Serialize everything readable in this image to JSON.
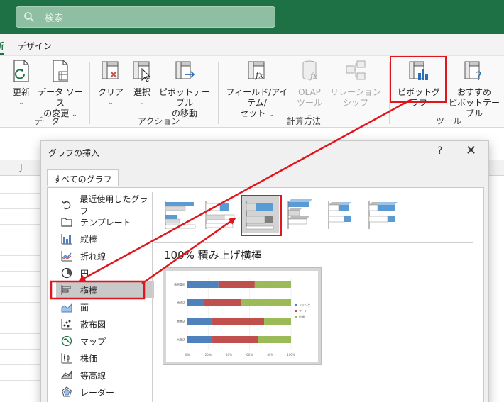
{
  "search": {
    "placeholder": "検索"
  },
  "ribbon": {
    "tabs": {
      "analyze": "析",
      "design": "デザイン"
    },
    "buttons": {
      "refresh": "更新",
      "datasource_1": "データ ソース",
      "datasource_2": "の変更",
      "clear": "クリア",
      "select": "選択",
      "move_1": "ピボットテーブル",
      "move_2": "の移動",
      "fields_1": "フィールド/アイテム/",
      "fields_2": "セット",
      "olap_1": "OLAP",
      "olap_2": "ツール",
      "relations": "リレーションシップ",
      "pivotchart": "ピボットグラフ",
      "recommended_1": "おすすめ",
      "recommended_2": "ピボットテーブル"
    },
    "groups": {
      "data": "データ",
      "actions": "アクション",
      "calculations": "計算方法",
      "tools": "ツール"
    }
  },
  "sheet": {
    "column_label": "J"
  },
  "dialog": {
    "title": "グラフの挿入",
    "help": "?",
    "close": "✕",
    "tab_all": "すべてのグラフ",
    "categories": [
      {
        "label": "最近使用したグラフ",
        "icon": "recent-icon"
      },
      {
        "label": "テンプレート",
        "icon": "folder-icon"
      },
      {
        "label": "縦棒",
        "icon": "column-chart-icon"
      },
      {
        "label": "折れ線",
        "icon": "line-chart-icon"
      },
      {
        "label": "円",
        "icon": "pie-chart-icon"
      },
      {
        "label": "横棒",
        "icon": "bar-chart-icon"
      },
      {
        "label": "面",
        "icon": "area-chart-icon"
      },
      {
        "label": "散布図",
        "icon": "scatter-chart-icon"
      },
      {
        "label": "マップ",
        "icon": "map-icon"
      },
      {
        "label": "株価",
        "icon": "stock-chart-icon"
      },
      {
        "label": "等高線",
        "icon": "surface-chart-icon"
      },
      {
        "label": "レーダー",
        "icon": "radar-chart-icon"
      }
    ],
    "selected_category": "横棒",
    "selected_subtype_title": "100% 積み上げ横棒"
  },
  "colors": {
    "excel_green": "#1e7145",
    "highlight_red": "#e0161c",
    "series_drink": "#4f81bd",
    "series_food": "#c0504d",
    "series_misc": "#9bbb59"
  },
  "chart_data": {
    "type": "bar",
    "stacking": "percent",
    "categories": [
      "長房屋根",
      "地崎店",
      "東東店",
      "大阪店"
    ],
    "series": [
      {
        "name": "ドリンク",
        "values": [
          30,
          16,
          23,
          24
        ]
      },
      {
        "name": "フード",
        "values": [
          35,
          36,
          51,
          44
        ]
      },
      {
        "name": "他雑",
        "values": [
          35,
          48,
          26,
          32
        ]
      }
    ],
    "xticks": [
      "0%",
      "20%",
      "40%",
      "60%",
      "80%",
      "100%"
    ],
    "xlim": [
      0,
      100
    ],
    "legend": "right"
  }
}
